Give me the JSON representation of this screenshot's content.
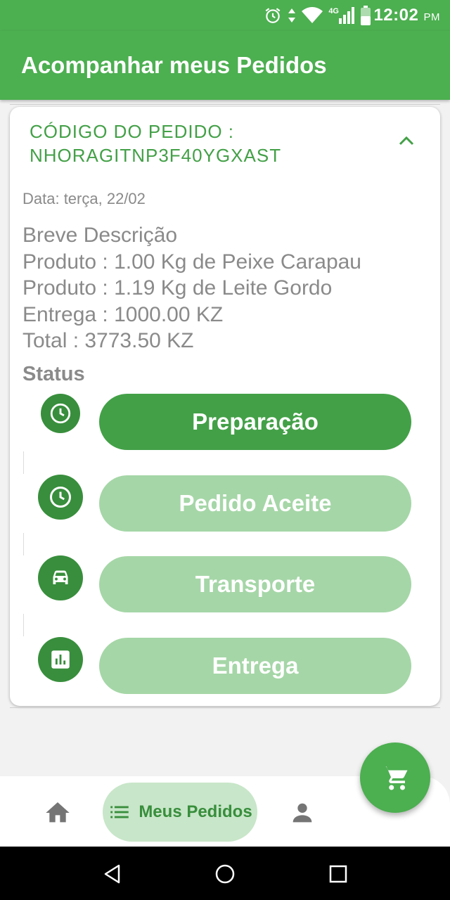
{
  "status_bar": {
    "time": "12:02",
    "ampm": "PM",
    "network": "4G",
    "icons": [
      "alarm-icon",
      "data-arrows-icon",
      "wifi-icon",
      "signal-icon",
      "battery-icon"
    ]
  },
  "header": {
    "title": "Acompanhar meus Pedidos"
  },
  "order": {
    "code_label": "CÓDIGO DO PEDIDO :",
    "code": "NHORAGITNP3F40YGXAST",
    "date": "Data: terça, 22/02",
    "description_title": "Breve Descrição",
    "lines": [
      "Produto : 1.00 Kg de Peixe Carapau",
      "Produto : 1.19 Kg de Leite Gordo",
      "Entrega : 1000.00 KZ",
      "Total : 3773.50 KZ"
    ],
    "status_title": "Status",
    "steps": [
      {
        "label": "Preparação",
        "icon": "clock-icon",
        "active": true
      },
      {
        "label": "Pedido Aceite",
        "icon": "clock-icon",
        "active": false
      },
      {
        "label": "Transporte",
        "icon": "car-icon",
        "active": false
      },
      {
        "label": "Entrega",
        "icon": "bar-chart-icon",
        "active": false
      }
    ]
  },
  "fab": {
    "icon": "cart-icon"
  },
  "bottom_nav": {
    "items": [
      {
        "icon": "home-icon"
      },
      {
        "icon": "list-icon",
        "label": "Meus Pedidos",
        "selected": true
      },
      {
        "icon": "person-icon"
      }
    ]
  },
  "colors": {
    "primary": "#4caf50",
    "primary_dark": "#388e3c",
    "active_step": "#43a047",
    "inactive_step": "#a5d6a7",
    "nav_pill": "#c8e6c9",
    "muted_text": "#8a8a8a"
  }
}
